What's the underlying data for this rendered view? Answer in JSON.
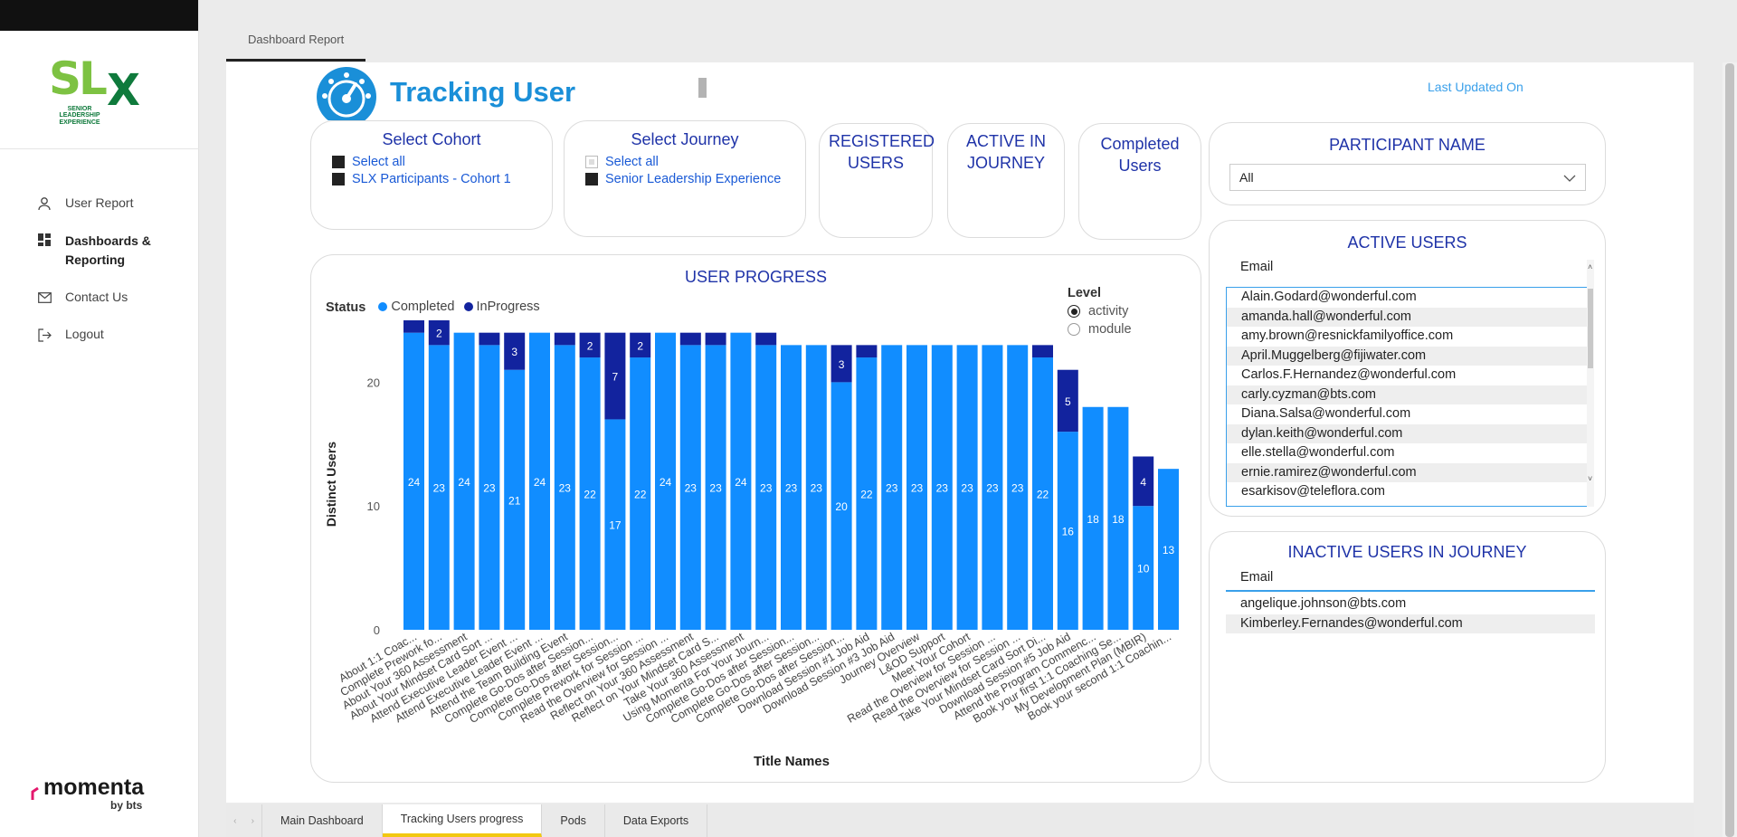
{
  "sidebar": {
    "logo_text": "SLX",
    "logo_tagline": "SENIOR LEADERSHIP EXPERIENCE",
    "nav": [
      {
        "label": "User Report",
        "icon": "user-icon"
      },
      {
        "label": "Dashboards & Reporting",
        "icon": "dashboard-icon"
      },
      {
        "label": "Contact Us",
        "icon": "mail-icon"
      },
      {
        "label": "Logout",
        "icon": "logout-icon"
      }
    ],
    "brand": "momenta",
    "brand_by": "by bts"
  },
  "top_tab": "Dashboard Report",
  "page": {
    "title": "Tracking User",
    "last_updated": "Last Updated On"
  },
  "cohort_slicer": {
    "title": "Select Cohort",
    "options": [
      {
        "label": "Select all",
        "checked": true
      },
      {
        "label": "SLX Participants - Cohort 1",
        "checked": true
      }
    ]
  },
  "journey_slicer": {
    "title": "Select Journey",
    "options": [
      {
        "label": "Select all",
        "checked": false
      },
      {
        "label": "Senior Leadership Experience",
        "checked": true
      }
    ]
  },
  "kpis": {
    "registered": "REGISTERED USERS",
    "active": "ACTIVE IN JOURNEY",
    "completed": "Completed Users"
  },
  "participant": {
    "title": "PARTICIPANT NAME",
    "selected": "All"
  },
  "active_users": {
    "title": "ACTIVE USERS",
    "column": "Email",
    "rows": [
      "Alain.Godard@wonderful.com",
      "amanda.hall@wonderful.com",
      "amy.brown@resnickfamilyoffice.com",
      "April.Muggelberg@fijiwater.com",
      "Carlos.F.Hernandez@wonderful.com",
      "carly.cyzman@bts.com",
      "Diana.Salsa@wonderful.com",
      "dylan.keith@wonderful.com",
      "elle.stella@wonderful.com",
      "ernie.ramirez@wonderful.com",
      "esarkisov@teleflora.com"
    ]
  },
  "inactive_users": {
    "title": "INACTIVE USERS IN JOURNEY",
    "column": "Email",
    "rows": [
      "angelique.johnson@bts.com",
      "Kimberley.Fernandes@wonderful.com"
    ]
  },
  "level_slicer": {
    "title": "Level",
    "options": [
      {
        "label": "activity",
        "selected": true
      },
      {
        "label": "module",
        "selected": false
      }
    ]
  },
  "chart_data": {
    "type": "bar",
    "stacked": true,
    "title": "USER PROGRESS",
    "legend_title": "Status",
    "legend_position": "top-left",
    "xlabel": "Title Names",
    "ylabel": "Distinct Users",
    "ylim": [
      0,
      25
    ],
    "yticks": [
      0,
      10,
      20
    ],
    "colors": {
      "Completed": "#118dff",
      "InProgress": "#12239e"
    },
    "categories": [
      "About 1:1 Coac...",
      "Complete Prework fo...",
      "About Your 360 Assessment",
      "About Your Mindset Card Sort ...",
      "Attend Executive Leader Event ...",
      "Attend Executive Leader Event ...",
      "Attend the Team Building Event",
      "Complete Go-Dos after Session...",
      "Complete Go-Dos after Session...",
      "Complete Prework for Session ...",
      "Read the Overview for Session ...",
      "Reflect on Your 360 Assessment",
      "Reflect on Your Mindset Card S...",
      "Take Your 360 Assessment",
      "Using Momenta For Your Journ...",
      "Complete Go-Dos after Session...",
      "Complete Go-Dos after Session...",
      "Complete Go-Dos after Session...",
      "Download Session #1 Job Aid",
      "Download Session #3 Job Aid",
      "Journey Overview",
      "L&OD Support",
      "Meet Your Cohort",
      "Read the Overview for Session ...",
      "Read the Overview for Session ...",
      "Take Your Mindset Card Sort Di...",
      "Download Session #5 Job Aid",
      "Attend the Program Commenc...",
      "Book your first 1:1 Coaching Se...",
      "My Development Plan (MBIR)",
      "Book your second 1:1 Coachin..."
    ],
    "series": [
      {
        "name": "Completed",
        "values": [
          24,
          23,
          24,
          23,
          21,
          24,
          23,
          22,
          17,
          22,
          24,
          23,
          23,
          24,
          23,
          23,
          23,
          20,
          22,
          23,
          23,
          23,
          23,
          23,
          23,
          22,
          16,
          18,
          18,
          10,
          13
        ]
      },
      {
        "name": "InProgress",
        "values": [
          1,
          2,
          0,
          1,
          3,
          0,
          1,
          2,
          7,
          2,
          0,
          1,
          1,
          0,
          1,
          0,
          0,
          3,
          1,
          0,
          0,
          0,
          0,
          0,
          0,
          1,
          5,
          0,
          0,
          4,
          0
        ]
      }
    ]
  },
  "bottom_tabs": [
    "Main Dashboard",
    "Tracking Users progress",
    "Pods",
    "Data Exports"
  ],
  "active_bottom_tab": "Tracking Users progress"
}
